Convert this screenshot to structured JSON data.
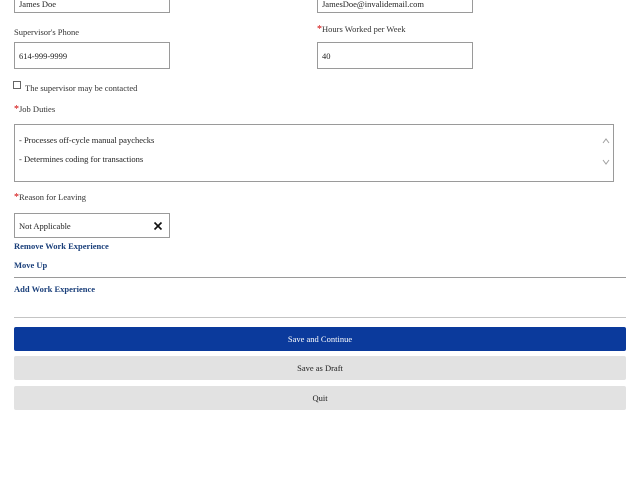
{
  "top_fields": {
    "left_value": "James Doe",
    "right_value": "JamesDoe@invalidemail.com"
  },
  "supervisor_phone": {
    "label": "Supervisor's Phone",
    "value": "614-999-9999"
  },
  "hours_worked": {
    "required_mark": "*",
    "label": "Hours Worked per Week",
    "value": "40"
  },
  "contact_checkbox": {
    "label": "The supervisor may be contacted",
    "checked": false
  },
  "job_duties": {
    "required_mark": "*",
    "label": "Job Duties",
    "lines": [
      "- Processes off-cycle manual paychecks",
      "- Determines coding for transactions"
    ]
  },
  "reason_for_leaving": {
    "required_mark": "*",
    "label": "Reason for Leaving",
    "value": "Not Applicable"
  },
  "links": {
    "remove": "Remove Work Experience",
    "move_up": "Move Up",
    "add": "Add Work Experience"
  },
  "buttons": {
    "save_continue": "Save and Continue",
    "save_draft": "Save as Draft",
    "quit": "Quit"
  },
  "colors": {
    "primary": "#0b3a9c",
    "secondary": "#e2e2e2",
    "link": "#1a3f7a",
    "required": "#d00000"
  },
  "icons": {
    "clear": "close-icon",
    "scroll_up": "chevron-up-icon",
    "scroll_down": "chevron-down-icon"
  }
}
